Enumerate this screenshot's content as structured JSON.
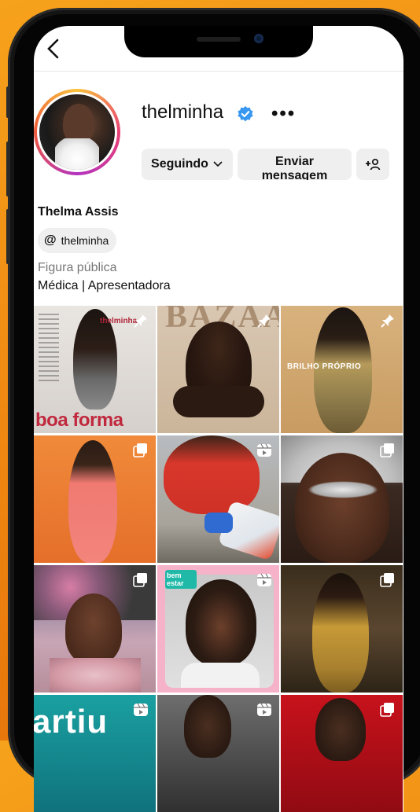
{
  "profile": {
    "username": "thelminha",
    "full_name": "Thelma Assis",
    "threads_handle": "thelminha",
    "category": "Figura pública",
    "bio": "Médica | Apresentadora"
  },
  "actions": {
    "following_label": "Seguindo",
    "message_label": "Enviar mensagem",
    "more_label": "•••",
    "add_user_label": "+A"
  },
  "grid": {
    "tile_texts": {
      "t1_header": "thelminha",
      "t1_title": "boa forma",
      "t2_title": "BAZAAR",
      "t3_title": "BRILHO PRÓPRIO",
      "t8_badge": "bem estar",
      "t10_title": "artiu"
    },
    "tiles": [
      {
        "id": "1",
        "type": "pinned"
      },
      {
        "id": "2",
        "type": "pinned"
      },
      {
        "id": "3",
        "type": "pinned"
      },
      {
        "id": "4",
        "type": "carousel"
      },
      {
        "id": "5",
        "type": "reel"
      },
      {
        "id": "6",
        "type": "carousel"
      },
      {
        "id": "7",
        "type": "carousel"
      },
      {
        "id": "8",
        "type": "reel"
      },
      {
        "id": "9",
        "type": "carousel"
      },
      {
        "id": "10",
        "type": "reel"
      },
      {
        "id": "11",
        "type": "reel"
      },
      {
        "id": "12",
        "type": "carousel"
      }
    ]
  },
  "colors": {
    "background": "#f19318",
    "verified": "#3897f0",
    "button_bg": "#efefef"
  }
}
